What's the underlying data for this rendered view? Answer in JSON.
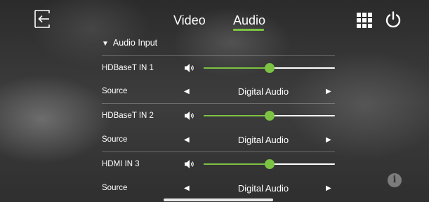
{
  "nav": {
    "tabs": [
      {
        "label": "Video",
        "active": false
      },
      {
        "label": "Audio",
        "active": true
      }
    ],
    "icons": [
      "exit-icon",
      "grid-icon",
      "power-icon"
    ],
    "accent_color": "#7cc243"
  },
  "audio_input": {
    "title": "Audio Input",
    "channels": [
      {
        "name": "HDBaseT IN 1",
        "volume_fraction": 0.5,
        "source_label": "Source",
        "source_value": "Digital Audio"
      },
      {
        "name": "HDBaseT IN 2",
        "volume_fraction": 0.5,
        "source_label": "Source",
        "source_value": "Digital Audio"
      },
      {
        "name": "HDMI IN 3",
        "volume_fraction": 0.5,
        "source_label": "Source",
        "source_value": "Digital Audio"
      }
    ]
  },
  "info": {
    "glyph": "i"
  }
}
